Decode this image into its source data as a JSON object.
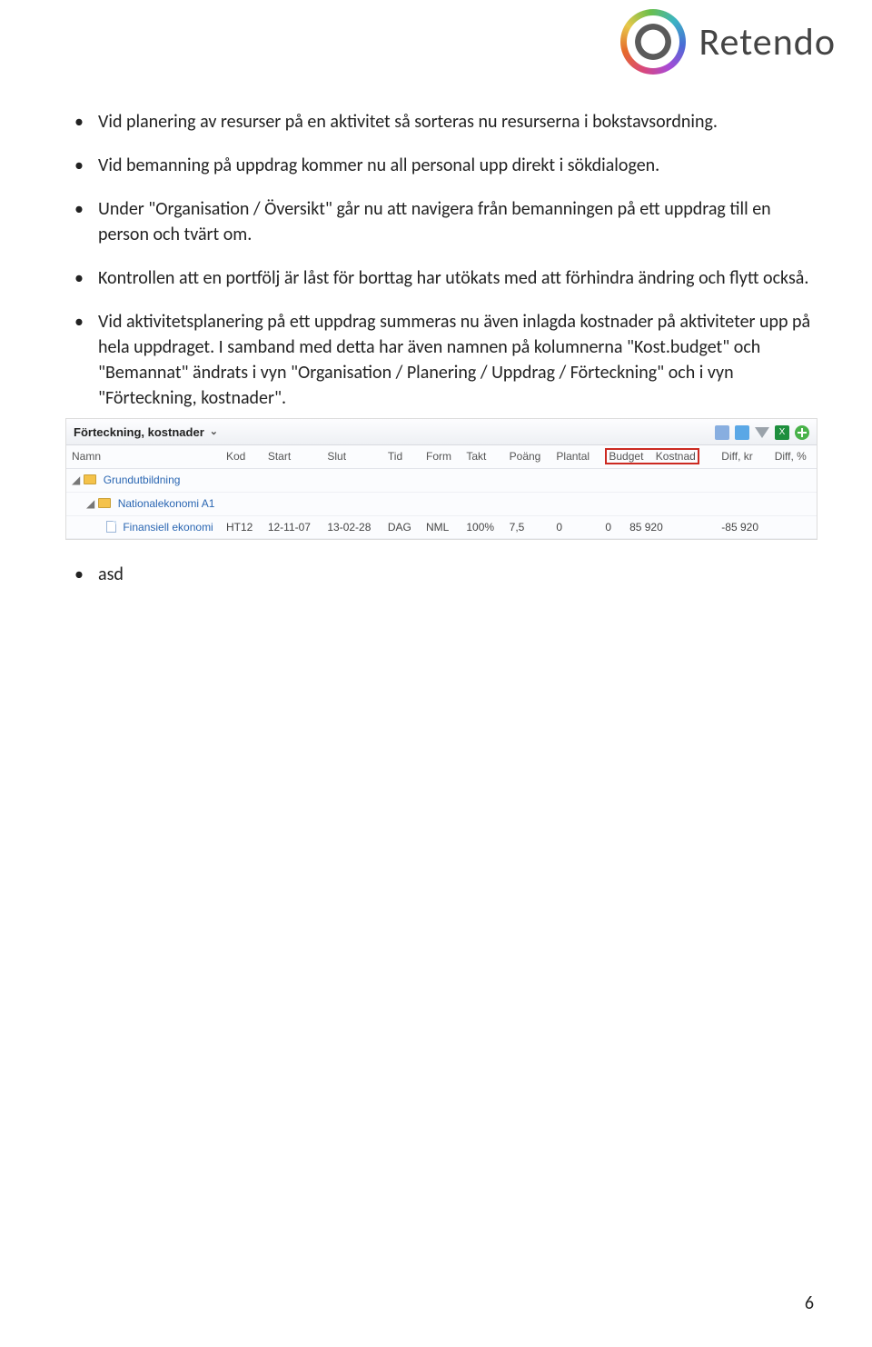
{
  "brand": {
    "name": "Retendo"
  },
  "bullets": [
    "Vid planering av resurser på en aktivitet så sorteras nu resurserna i bokstavsordning.",
    "Vid bemanning på uppdrag kommer nu all personal upp direkt i sökdialogen.",
    "Under \"Organisation / Översikt\" går nu att navigera från bemanningen på ett uppdrag till en person och tvärt om.",
    "Kontrollen att en portfölj är låst för borttag har utökats med att förhindra ändring och flytt också.",
    "Vid aktivitetsplanering på ett uppdrag summeras nu även inlagda kostnader på aktiviteter upp på hela uppdraget. I samband med detta har även namnen på kolumnerna \"Kost.budget\" och \"Bemannat\" ändrats i vyn \"Organisation / Planering / Uppdrag / Förteckning\" och i vyn \"Förteckning, kostnader\".",
    "asd"
  ],
  "panel": {
    "title": "Förteckning, kostnader",
    "headers": {
      "namn": "Namn",
      "kod": "Kod",
      "start": "Start",
      "slut": "Slut",
      "tid": "Tid",
      "form": "Form",
      "takt": "Takt",
      "poang": "Poäng",
      "plantal": "Plantal",
      "budget": "Budget",
      "kostnad": "Kostnad",
      "diffkr": "Diff, kr",
      "diffp": "Diff, %"
    },
    "rows": [
      {
        "kind": "folder",
        "indent": 0,
        "namn": "Grundutbildning"
      },
      {
        "kind": "folder",
        "indent": 1,
        "namn": "Nationalekonomi A1"
      },
      {
        "kind": "doc",
        "indent": 2,
        "namn": "Finansiell ekonomi",
        "kod": "HT12",
        "start": "12-11-07",
        "slut": "13-02-28",
        "tid": "DAG",
        "form": "NML",
        "takt": "100%",
        "poang": "7,5",
        "plantal": "0",
        "budget": "0",
        "kostnad": "85 920",
        "diffkr": "-85 920",
        "diffp": ""
      }
    ]
  },
  "page_number": "6"
}
